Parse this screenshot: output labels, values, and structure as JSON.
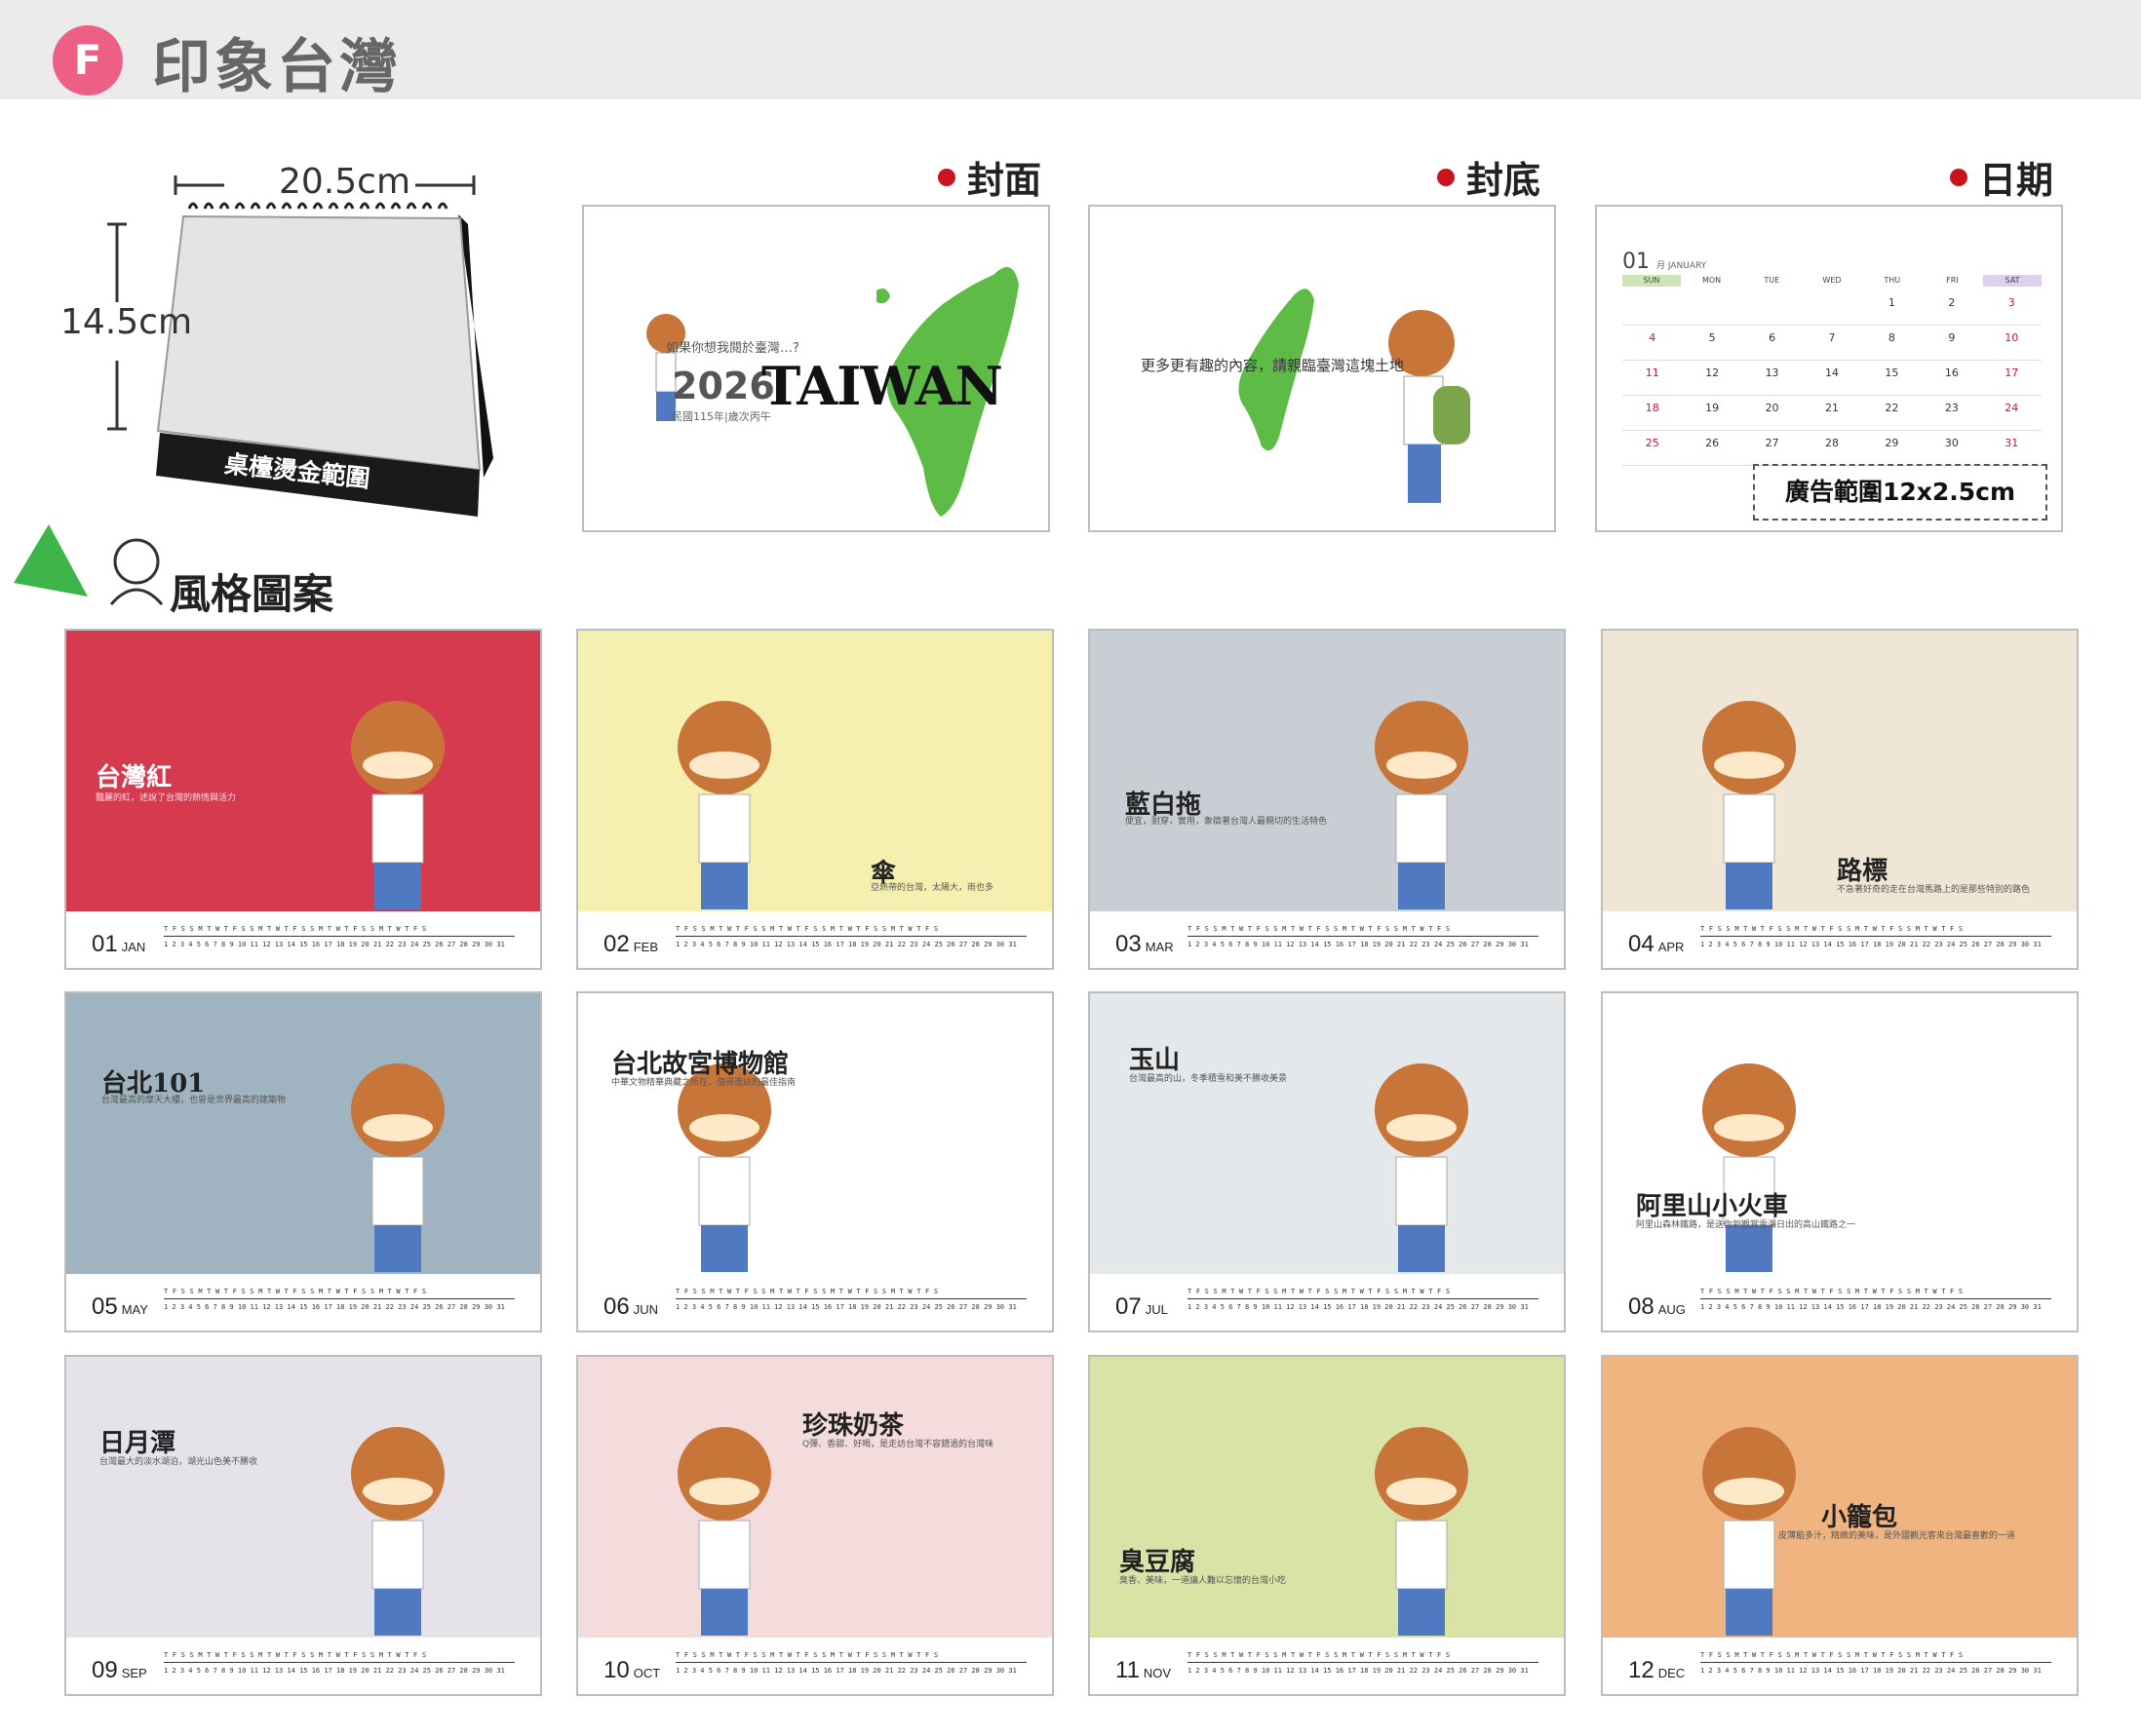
{
  "header": {
    "badge": "F",
    "title": "印象台灣"
  },
  "desk": {
    "width_label": "20.5cm",
    "height_label": "14.5cm",
    "caption": "桌檯燙金範圍"
  },
  "sections": {
    "cover": "封面",
    "back": "封底",
    "date": "日期"
  },
  "cover": {
    "question": "如果你想我閱於臺灣…?",
    "year": "2026",
    "subtitle": "民國115年|歲次丙午",
    "word": "TAIWAN"
  },
  "back": {
    "text": "更多更有趣的內容，請親臨臺灣這塊土地"
  },
  "date_page": {
    "month": "01",
    "month_en": "月 JANUARY",
    "weekdays": [
      "SUN",
      "MON",
      "TUE",
      "WED",
      "THU",
      "FRI",
      "SAT"
    ],
    "days": [
      "",
      "",
      "",
      "",
      "1",
      "2",
      "3",
      "4",
      "5",
      "6",
      "7",
      "8",
      "9",
      "10",
      "11",
      "12",
      "13",
      "14",
      "15",
      "16",
      "17",
      "18",
      "19",
      "20",
      "21",
      "22",
      "23",
      "24",
      "25",
      "26",
      "27",
      "28",
      "29",
      "30",
      "31"
    ],
    "ad_label": "廣告範圍12x2.5cm"
  },
  "style_heading": "風格圖案",
  "months": [
    {
      "num": "01",
      "en": "JAN",
      "title": "台灣紅",
      "caption": "豔麗的紅，述說了台灣的熱情與活力",
      "bg": "#d63a4e",
      "light": true
    },
    {
      "num": "02",
      "en": "FEB",
      "title": "傘",
      "caption": "亞熱帶的台灣，太陽大，雨也多",
      "bg": "#f6f0b0",
      "light": false
    },
    {
      "num": "03",
      "en": "MAR",
      "title": "藍白拖",
      "caption": "便宜，耐穿，實用，象徵著台灣人最親切的生活特色",
      "bg": "#c9cdd4",
      "light": false
    },
    {
      "num": "04",
      "en": "APR",
      "title": "路標",
      "caption": "不急著好奇的走在台灣馬路上的是那些特別的路色",
      "bg": "#efe6d6",
      "light": false
    },
    {
      "num": "05",
      "en": "MAY",
      "title": "台北101",
      "caption": "台灣最高的摩天大樓，也曾是世界最高的建築物",
      "bg": "#9fb4c0",
      "light": false
    },
    {
      "num": "06",
      "en": "JUN",
      "title": "台北故宮博物館",
      "caption": "中華文物精華典藏之所在，值得造訪的最佳指南",
      "bg": "#ffffff",
      "light": false
    },
    {
      "num": "07",
      "en": "JUL",
      "title": "玉山",
      "caption": "台灣最高的山，冬季積雪和美不勝收美景",
      "bg": "#e4e8ea",
      "light": false
    },
    {
      "num": "08",
      "en": "AUG",
      "title": "阿里山小火車",
      "caption": "阿里山森林鐵路，是送你到觀賞雲海日出的高山鐵路之一",
      "bg": "#ffffff",
      "light": false
    },
    {
      "num": "09",
      "en": "SEP",
      "title": "日月潭",
      "caption": "台灣最大的淡水湖泊，湖光山色美不勝收",
      "bg": "#e6e2ea",
      "light": false
    },
    {
      "num": "10",
      "en": "OCT",
      "title": "珍珠奶茶",
      "caption": "Q彈、香甜、好喝，是走訪台灣不容錯過的台灣味",
      "bg": "#f5dcdc",
      "light": false
    },
    {
      "num": "11",
      "en": "NOV",
      "title": "臭豆腐",
      "caption": "臭香、美味，一道讓人難以忘懷的台灣小吃",
      "bg": "#d9e3a6",
      "light": false
    },
    {
      "num": "12",
      "en": "DEC",
      "title": "小籠包",
      "caption": "皮薄餡多汁，精緻的美味，是外國觀光客來台灣最喜歡的一道",
      "bg": "#efb480",
      "light": false
    }
  ],
  "strip": {
    "weekday_row": "T F S S M T W T F S S M T W T F S S M T W T F S S M T W T F S",
    "number_row": "1 2 3 4 5 6 7 8 9 10 11 12 13 14 15 16 17 18 19 20 21 22 23 24 25 26 27 28 29 30 31"
  },
  "colors": {
    "accent_pink": "#ee5f86",
    "red_dot": "#c9141e",
    "map_green": "#5dbb46"
  }
}
